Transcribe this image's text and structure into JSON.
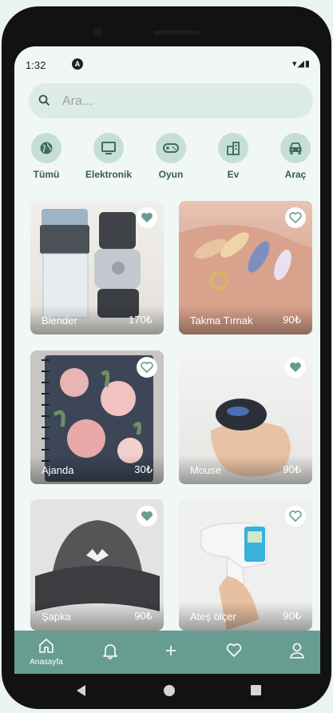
{
  "status_bar": {
    "time": "1:32",
    "notif_icon": "A",
    "right_icons": "▾◢▮"
  },
  "search": {
    "placeholder": "Ara..."
  },
  "categories": [
    {
      "label": "Tümü",
      "icon": "globe-icon"
    },
    {
      "label": "Elektronik",
      "icon": "tv-icon"
    },
    {
      "label": "Oyun",
      "icon": "gamepad-icon"
    },
    {
      "label": "Ev",
      "icon": "building-icon"
    },
    {
      "label": "Araç",
      "icon": "car-icon"
    }
  ],
  "products": [
    {
      "name": "Blender",
      "price": "170₺",
      "favorited": true
    },
    {
      "name": "Takma Tırnak",
      "price": "90₺",
      "favorited": false
    },
    {
      "name": "Ajanda",
      "price": "30₺",
      "favorited": false
    },
    {
      "name": "Mouse",
      "price": "90₺",
      "favorited": true
    },
    {
      "name": "Şapka",
      "price": "90₺",
      "favorited": true
    },
    {
      "name": "Ateş ölçer",
      "price": "90₺",
      "favorited": false
    }
  ],
  "bottom_nav": {
    "home_label": "Anasayfa"
  },
  "colors": {
    "accent": "#679d90",
    "category_bg": "#c5dfd8",
    "category_text": "#365c52",
    "search_bg": "#dcebe7"
  }
}
